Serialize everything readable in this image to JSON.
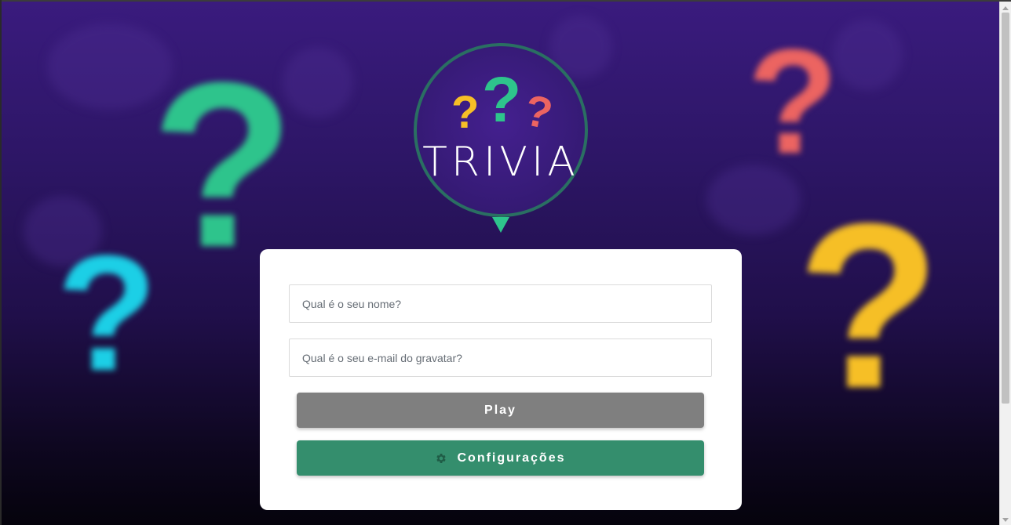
{
  "logo": {
    "title": "TRIVIA",
    "question_marks": [
      "?",
      "?",
      "?"
    ],
    "colors": {
      "yellow": "#f6bf26",
      "green": "#2ec48c",
      "coral": "#ec6461",
      "ring": "#2a6f62"
    }
  },
  "background": {
    "question_mark": "?",
    "colors": {
      "green": "#2ec48c",
      "cyan": "#1ccfe6",
      "coral": "#ec6461",
      "yellow": "#f6bf26"
    }
  },
  "form": {
    "name_placeholder": "Qual é o seu nome?",
    "email_placeholder": "Qual é o seu e-mail do gravatar?",
    "play_label": "Play",
    "settings_label": "Configurações",
    "settings_icon": "gear-icon"
  },
  "colors": {
    "play_button": "#7f7f7f",
    "settings_button": "#348e6d"
  }
}
